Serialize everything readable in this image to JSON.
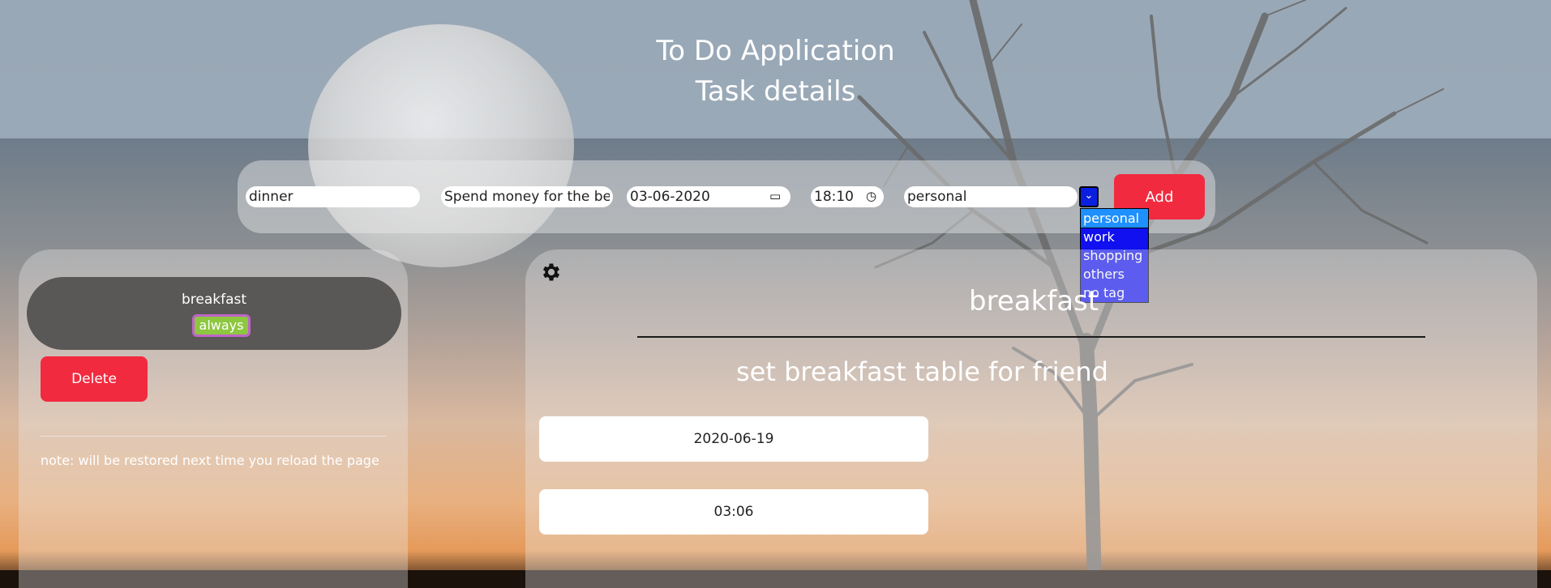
{
  "header": {
    "app_title": "To Do Application",
    "subtitle": "Task details"
  },
  "form": {
    "name_value": "dinner",
    "description_value": "Spend money for the bes",
    "date_value": "03-06-2020",
    "time_value": "18:10",
    "tag_value": "personal",
    "add_label": "Add",
    "tag_options": [
      "personal",
      "work",
      "shopping",
      "others",
      "no tag"
    ],
    "selected_option_index": 0
  },
  "task_list": {
    "items": [
      {
        "title": "breakfast",
        "tag": "always"
      }
    ],
    "delete_label": "Delete",
    "note": "note: will be restored next time you reload the page"
  },
  "details": {
    "title": "breakfast",
    "description": "set breakfast table for friend",
    "date": "2020-06-19",
    "time": "03:06"
  },
  "icons": {
    "settings": "gear-icon",
    "calendar": "calendar-icon",
    "clock": "clock-icon",
    "dropdown": "chevron-down-icon"
  },
  "colors": {
    "accent_button": "#f22a3f",
    "tag_badge": "#8dc73f",
    "tag_badge_border": "#c064c8",
    "dropdown_bg": "#1010f0",
    "task_card": "#5a5856"
  }
}
